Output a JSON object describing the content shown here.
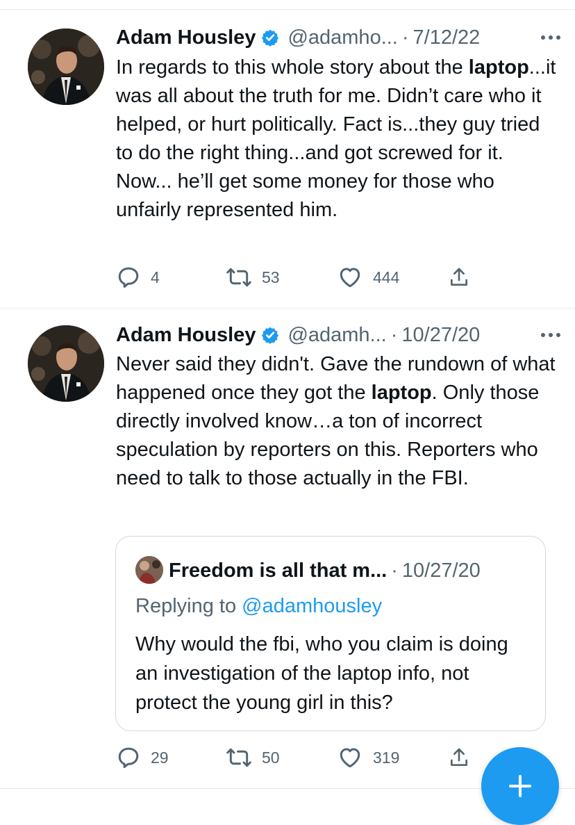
{
  "tweets": [
    {
      "author": "Adam Housley",
      "handle": "@adamho...",
      "separator": "·",
      "date": "7/12/22",
      "avatar_icon": "profile-photo",
      "text_parts": {
        "p1": "In regards to this whole story about the ",
        "bold": "laptop",
        "p2": "...it was all about the truth for me. Didn’t care who it helped, or hurt politically. Fact is...they guy tried to do the right thing...and got screwed for it. Now... he’ll get some money for those who unfairly represented him."
      },
      "actions": {
        "replies": "4",
        "retweets": "53",
        "likes": "444"
      }
    },
    {
      "author": "Adam Housley",
      "handle": "@adamh...",
      "separator": "·",
      "date": "10/27/20",
      "avatar_icon": "profile-photo",
      "text_parts": {
        "p1": "Never said they didn't. Gave the rundown of what happened once they got the ",
        "bold": "laptop",
        "p2": ". Only those directly involved know…a ton of incorrect speculation by reporters on this. Reporters who need to talk to those actually in the FBI."
      },
      "quote": {
        "author": "Freedom is all that m...",
        "separator": "·",
        "date": "10/27/20",
        "replying_prefix": "Replying to ",
        "replying_handle": "@adamhousley",
        "text": "Why would the fbi, who you claim is doing an investigation of the laptop info, not protect the young girl in this?"
      },
      "actions": {
        "replies": "29",
        "retweets": "50",
        "likes": "319"
      }
    }
  ],
  "icons": {
    "verified": "verified-badge-icon",
    "more": "more-dots-icon",
    "reply": "reply-icon",
    "retweet": "retweet-icon",
    "like": "heart-icon",
    "share": "share-icon",
    "compose": "plus-icon"
  },
  "colors": {
    "accent": "#1d9bf0",
    "text": "#0f1419",
    "secondary": "#536471",
    "border": "#cfd9de"
  }
}
